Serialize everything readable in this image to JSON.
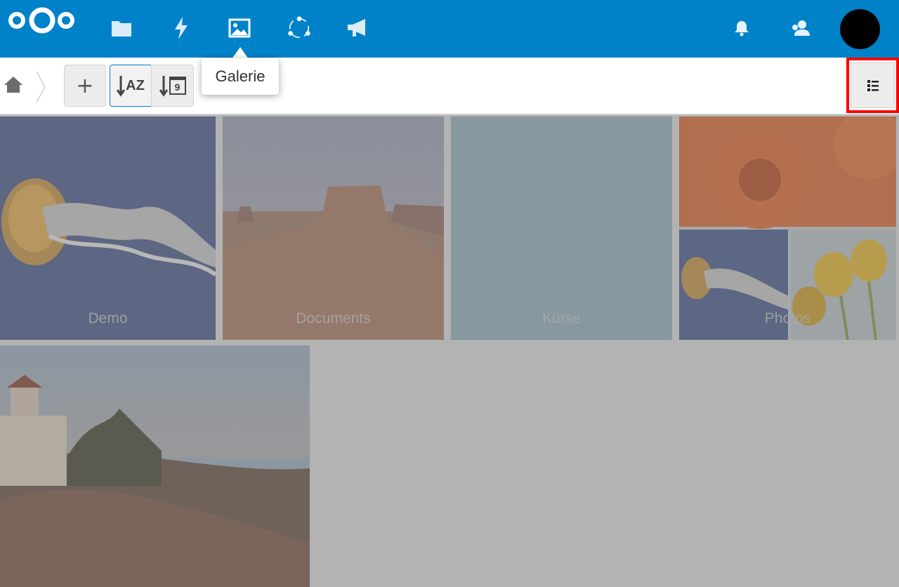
{
  "header": {
    "nav_icons": [
      "files-icon",
      "activity-icon",
      "gallery-icon",
      "circles-icon",
      "announcements-icon"
    ],
    "right_icons": [
      "notifications-icon",
      "contacts-icon"
    ],
    "accent_color": "#0082c9"
  },
  "tooltip": {
    "text": "Galerie"
  },
  "toolbar": {
    "add_label": "+",
    "sort_name_label": "AZ",
    "sort_date_label": "9"
  },
  "gallery": {
    "albums": [
      {
        "label": "Demo"
      },
      {
        "label": "Documents"
      },
      {
        "label": "Kurse"
      },
      {
        "label": "Photos"
      }
    ]
  }
}
